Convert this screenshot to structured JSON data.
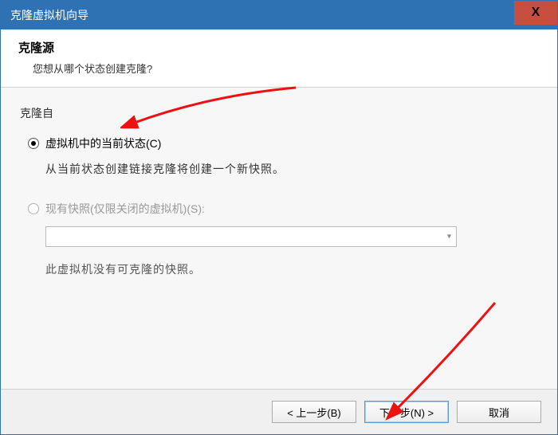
{
  "window": {
    "title": "克隆虚拟机向导"
  },
  "close": {
    "glyph": "X"
  },
  "header": {
    "title": "克隆源",
    "subtitle": "您想从哪个状态创建克隆?"
  },
  "group": {
    "label": "克隆自"
  },
  "option1": {
    "label": "虚拟机中的当前状态(C)",
    "desc": "从当前状态创建链接克隆将创建一个新快照。"
  },
  "option2": {
    "label": "现有快照(仅限关闭的虚拟机)(S):",
    "desc": "此虚拟机没有可克隆的快照。"
  },
  "select": {
    "arrow": "▾"
  },
  "buttons": {
    "back": "< 上一步(B)",
    "next": "下一步(N) >",
    "cancel": "取消"
  }
}
